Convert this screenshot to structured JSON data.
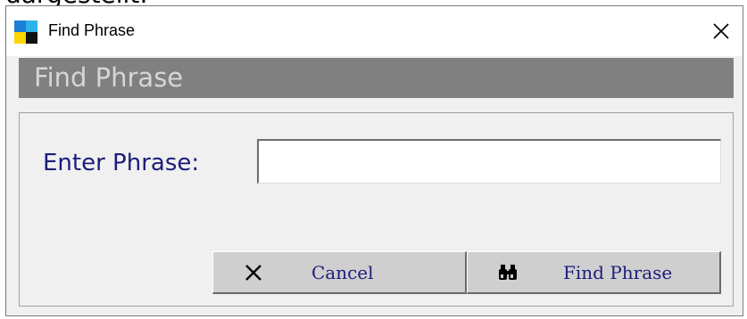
{
  "background_caption": "dargestellt:",
  "window": {
    "title": "Find Phrase",
    "app_icon": "app-logo-icon",
    "close_icon": "close-icon"
  },
  "banner": {
    "title": "Find Phrase"
  },
  "form": {
    "phrase_label": "Enter Phrase:",
    "phrase_value": "",
    "phrase_placeholder": ""
  },
  "buttons": {
    "cancel": {
      "label": "Cancel",
      "icon": "x-icon"
    },
    "find": {
      "label": "Find Phrase",
      "icon": "binoculars-icon"
    }
  },
  "colors": {
    "banner_bg": "#808080",
    "banner_text": "#d6d6d6",
    "label_text": "#1c1c7a",
    "button_face": "#cfcfcf",
    "window_bg": "#f0f0f0"
  }
}
